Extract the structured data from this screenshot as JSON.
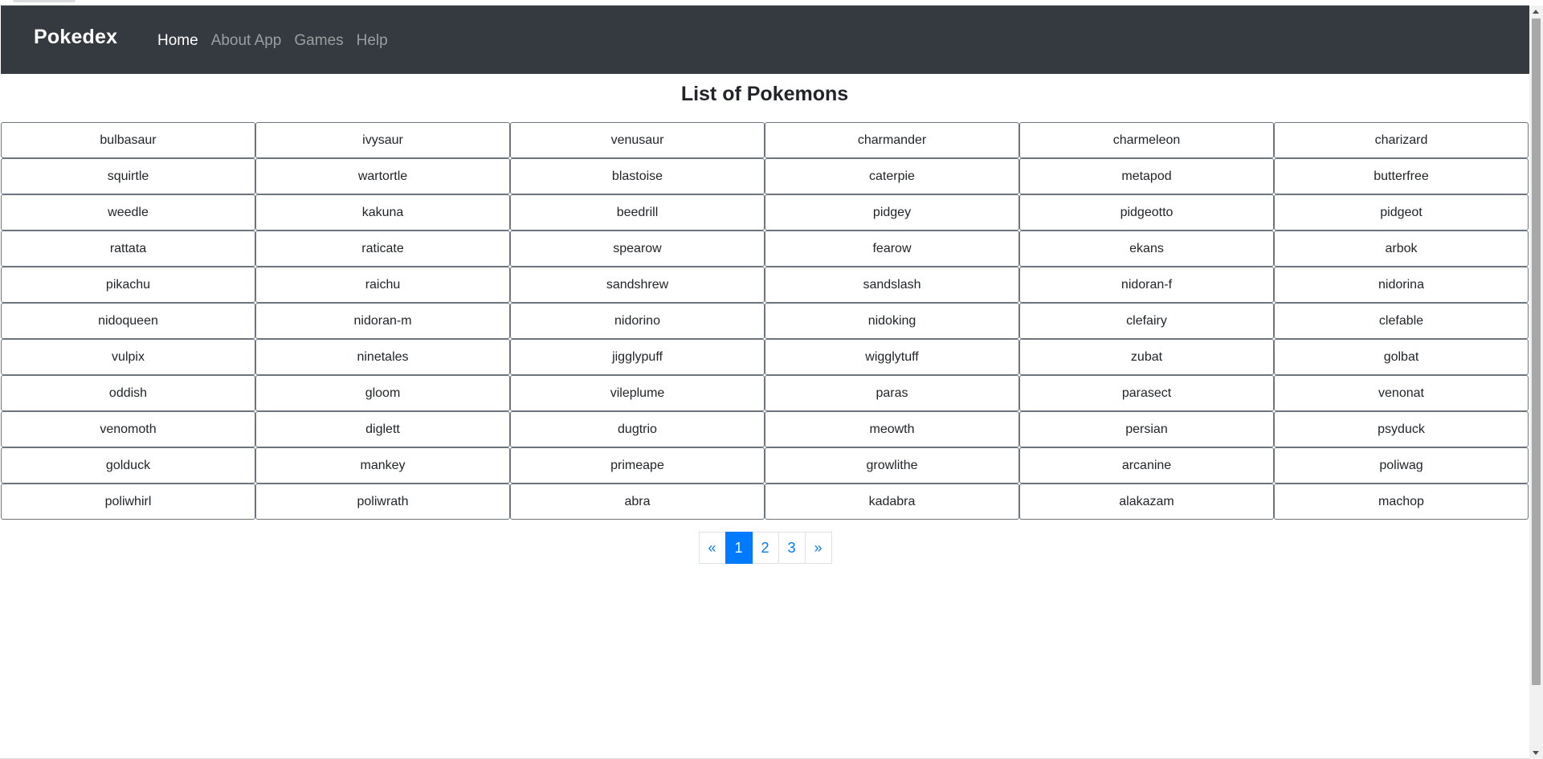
{
  "navbar": {
    "brand": "Pokedex",
    "links": [
      {
        "label": "Home",
        "active": true
      },
      {
        "label": "About App",
        "active": false
      },
      {
        "label": "Games",
        "active": false
      },
      {
        "label": "Help",
        "active": false
      }
    ]
  },
  "main": {
    "title": "List of Pokemons",
    "pokemons": [
      "bulbasaur",
      "ivysaur",
      "venusaur",
      "charmander",
      "charmeleon",
      "charizard",
      "squirtle",
      "wartortle",
      "blastoise",
      "caterpie",
      "metapod",
      "butterfree",
      "weedle",
      "kakuna",
      "beedrill",
      "pidgey",
      "pidgeotto",
      "pidgeot",
      "rattata",
      "raticate",
      "spearow",
      "fearow",
      "ekans",
      "arbok",
      "pikachu",
      "raichu",
      "sandshrew",
      "sandslash",
      "nidoran-f",
      "nidorina",
      "nidoqueen",
      "nidoran-m",
      "nidorino",
      "nidoking",
      "clefairy",
      "clefable",
      "vulpix",
      "ninetales",
      "jigglypuff",
      "wigglytuff",
      "zubat",
      "golbat",
      "oddish",
      "gloom",
      "vileplume",
      "paras",
      "parasect",
      "venonat",
      "venomoth",
      "diglett",
      "dugtrio",
      "meowth",
      "persian",
      "psyduck",
      "golduck",
      "mankey",
      "primeape",
      "growlithe",
      "arcanine",
      "poliwag",
      "poliwhirl",
      "poliwrath",
      "abra",
      "kadabra",
      "alakazam",
      "machop"
    ]
  },
  "pagination": {
    "prev_label": "«",
    "next_label": "»",
    "pages": [
      "1",
      "2",
      "3"
    ],
    "current_page": "1",
    "active_color": "#007bff"
  },
  "colors": {
    "navbar_bg": "#343a40",
    "link_color": "#007bff",
    "cell_border": "#6c757d"
  }
}
